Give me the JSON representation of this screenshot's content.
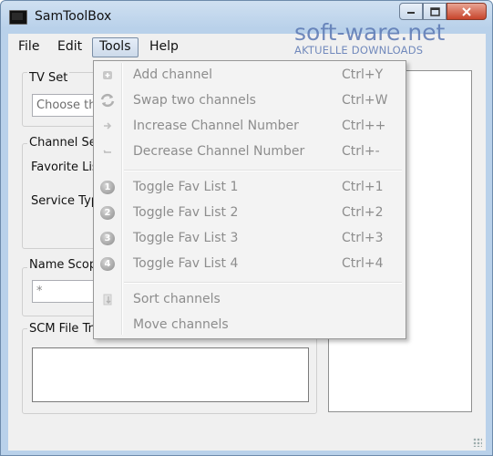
{
  "window": {
    "title": "SamToolBox"
  },
  "menubar": {
    "items": [
      "File",
      "Edit",
      "Tools",
      "Help"
    ],
    "active": "Tools"
  },
  "watermark": {
    "brand": "soft-ware.net",
    "tagline": "AKTUELLE DOWNLOADS"
  },
  "tv_set": {
    "label": "TV Set",
    "placeholder": "Choose th"
  },
  "channel_settings": {
    "label": "Channel Se",
    "favorite_label": "Favorite Lis",
    "service_label": "Service Typ"
  },
  "name_scope": {
    "label": "Name Scop",
    "value": "*"
  },
  "scm_file": {
    "label": "SCM File Tr"
  },
  "tools_menu": {
    "items": [
      {
        "label": "Add channel",
        "shortcut": "Ctrl+Y",
        "icon": "add-channel-icon"
      },
      {
        "label": "Swap two channels",
        "shortcut": "Ctrl+W",
        "icon": "swap-icon"
      },
      {
        "label": "Increase Channel Number",
        "shortcut": "Ctrl++",
        "icon": "increase-icon"
      },
      {
        "label": "Decrease Channel Number",
        "shortcut": "Ctrl+-",
        "icon": "decrease-icon"
      },
      {
        "label": "Toggle Fav List 1",
        "shortcut": "Ctrl+1",
        "icon": "heart-1-icon",
        "num": "1"
      },
      {
        "label": "Toggle Fav List 2",
        "shortcut": "Ctrl+2",
        "icon": "heart-2-icon",
        "num": "2"
      },
      {
        "label": "Toggle Fav List 3",
        "shortcut": "Ctrl+3",
        "icon": "heart-3-icon",
        "num": "3"
      },
      {
        "label": "Toggle Fav List 4",
        "shortcut": "Ctrl+4",
        "icon": "heart-4-icon",
        "num": "4"
      },
      {
        "label": "Sort channels",
        "shortcut": "",
        "icon": "sort-icon"
      },
      {
        "label": "Move channels",
        "shortcut": "",
        "icon": ""
      }
    ]
  },
  "colors": {
    "titlebar": "#b9d1ea",
    "close_button": "#c8452c",
    "disabled_text": "#8d8d8d",
    "watermark": "#5b78b3"
  }
}
